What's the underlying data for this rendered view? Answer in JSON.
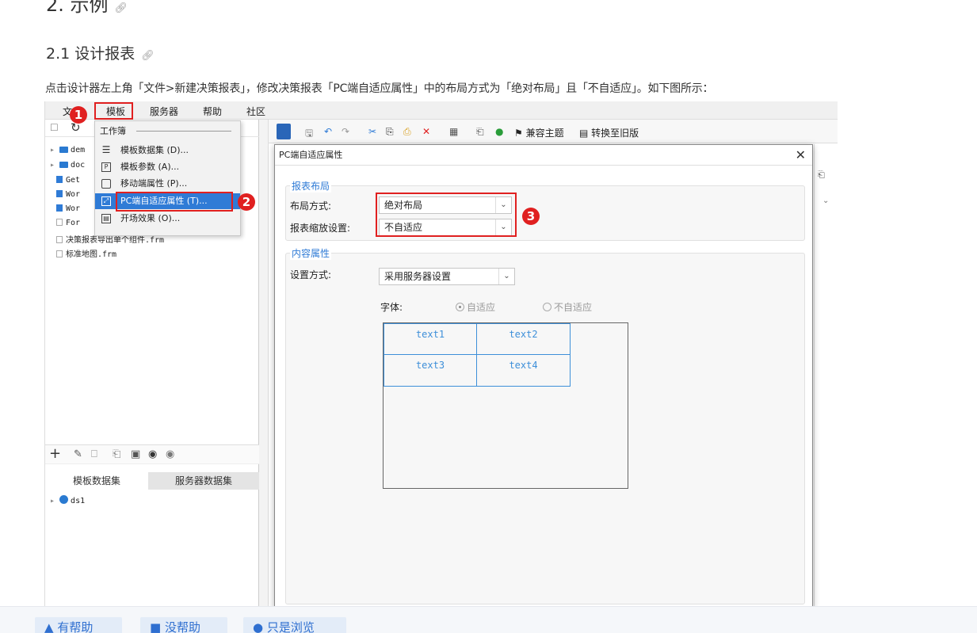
{
  "doc": {
    "h2": "2. 示例",
    "h3": "2.1 设计报表",
    "intro": "点击设计器左上角「文件>新建决策报表」，修改决策报表「PC端自适应属性」中的布局方式为「绝对布局」且「不自适应」。如下图所示："
  },
  "app": {
    "menubar": [
      "文",
      "模板",
      "服务器",
      "帮助",
      "社区"
    ],
    "tree": [
      {
        "label": "dem",
        "kind": "folder"
      },
      {
        "label": "doc",
        "kind": "folder"
      },
      {
        "label": "Get",
        "kind": "report"
      },
      {
        "label": "Wor",
        "kind": "report"
      },
      {
        "label": "Wor",
        "kind": "report"
      },
      {
        "label": "For",
        "kind": "form"
      },
      {
        "label": "决策报表导出单个组件.frm",
        "kind": "form"
      },
      {
        "label": "标准地图.frm",
        "kind": "form"
      }
    ],
    "dataset_tabs": [
      "模板数据集",
      "服务器数据集"
    ],
    "datasets": [
      "ds1"
    ],
    "menu": {
      "section": "工作簿",
      "items": [
        {
          "label": "模板数据集 (D)...",
          "icon": "database-icon"
        },
        {
          "label": "模板参数 (A)...",
          "icon": "parameter-icon"
        },
        {
          "label": "移动端属性 (P)...",
          "icon": "mobile-icon"
        },
        {
          "label": "PC端自适应属性 (T)...",
          "icon": "expand-icon"
        },
        {
          "label": "开场效果 (O)...",
          "icon": "film-icon"
        }
      ]
    },
    "toolbar": {
      "compat_theme": "兼容主题",
      "convert_old": "转换至旧版"
    },
    "badges": [
      "1",
      "2",
      "3"
    ]
  },
  "dialog": {
    "title": "PC端自适应属性",
    "layout_group": "报表布局",
    "layout_label": "布局方式:",
    "layout_value": "绝对布局",
    "scale_label": "报表缩放设置:",
    "scale_value": "不自适应",
    "content_group": "内容属性",
    "setting_label": "设置方式:",
    "setting_value": "采用服务器设置",
    "font_label": "字体:",
    "font_opt1": "自适应",
    "font_opt2": "不自适应",
    "cells": [
      "text1",
      "text2",
      "text3",
      "text4"
    ]
  },
  "footer": {
    "helpful": "有帮助",
    "not_helpful": "没帮助",
    "just_browsing": "只是浏览"
  }
}
